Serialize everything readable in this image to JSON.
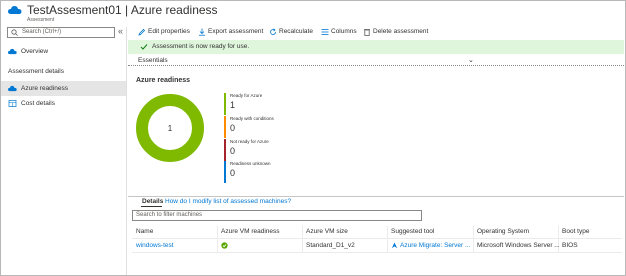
{
  "header": {
    "title": "TestAssesment01 | Azure readiness",
    "subtitle": "Assessment"
  },
  "sidebar": {
    "search_placeholder": "Search (Ctrl+/)",
    "collapse_glyph": "«",
    "overview_label": "Overview",
    "section_label": "Assessment details",
    "items": [
      {
        "label": "Azure readiness",
        "active": true
      },
      {
        "label": "Cost details",
        "active": false
      }
    ]
  },
  "toolbar": {
    "buttons": [
      {
        "label": "Edit properties",
        "icon": "pencil-icon"
      },
      {
        "label": "Export assessment",
        "icon": "download-icon"
      },
      {
        "label": "Recalculate",
        "icon": "refresh-icon"
      },
      {
        "label": "Columns",
        "icon": "columns-icon"
      },
      {
        "label": "Delete assessment",
        "icon": "trash-icon"
      }
    ]
  },
  "banner": {
    "message": "Assessment is now ready for use."
  },
  "essentials": {
    "label": "Essentials",
    "chevron": "⌄"
  },
  "readiness": {
    "title": "Azure readiness",
    "center_value": "1",
    "legend": [
      {
        "name": "Ready for Azure",
        "value": "1",
        "color": "#7fba00"
      },
      {
        "name": "Ready with conditions",
        "value": "0",
        "color": "#ff8c00"
      },
      {
        "name": "Not ready for Azure",
        "value": "0",
        "color": "#a4262c"
      },
      {
        "name": "Readiness unknown",
        "value": "0",
        "color": "#0078d4"
      }
    ]
  },
  "details": {
    "tab_label": "Details",
    "help_link": "How do I modify list of assessed machines?",
    "filter_placeholder": "Search to filter machines",
    "columns": [
      "Name",
      "Azure VM readiness",
      "Azure VM size",
      "Suggested tool",
      "Operating System",
      "Boot type"
    ],
    "rows": [
      {
        "name": "windows-test",
        "readiness_icon": "green-check-icon",
        "vm_size": "Standard_D1_v2",
        "tool": "Azure Migrate: Server ...",
        "os": "Microsoft Windows Server ...",
        "boot": "BIOS"
      }
    ]
  },
  "colors": {
    "accent": "#0078d4",
    "banner_bg": "#dff6dd",
    "ready_green": "#7fba00"
  }
}
